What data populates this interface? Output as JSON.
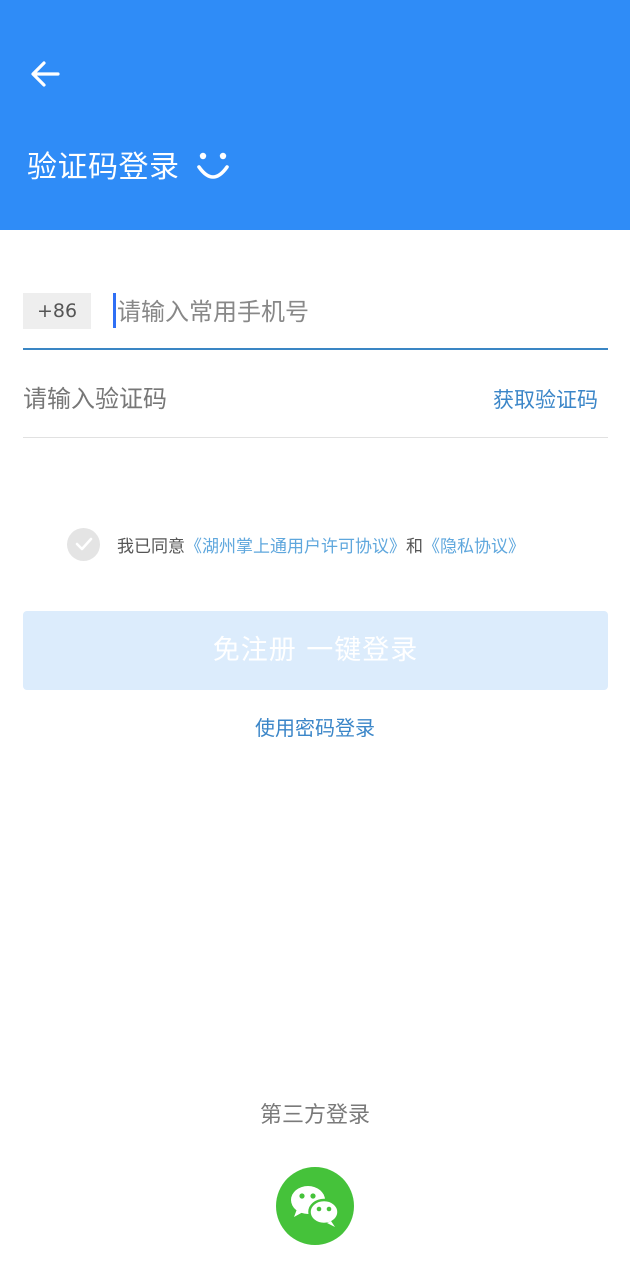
{
  "header": {
    "title": "验证码登录",
    "background_color": "#2f8cf7",
    "back_icon": "back-arrow-icon",
    "title_icon": "smile-icon"
  },
  "phone": {
    "country_code": "+86",
    "placeholder": "请输入常用手机号",
    "value": ""
  },
  "verify": {
    "placeholder": "请输入验证码",
    "value": "",
    "get_code_label": "获取验证码"
  },
  "agreement": {
    "checked": false,
    "prefix": "我已同意",
    "user_agreement": "《湖州掌上通用户许可协议》",
    "conjunction": "和",
    "privacy_policy": "《隐私协议》",
    "link_color": "#5fa7dd"
  },
  "login_button": {
    "label": "免注册 一键登录",
    "background_color": "#dcecfc"
  },
  "password_login": {
    "label": "使用密码登录"
  },
  "third_party": {
    "label": "第三方登录",
    "wechat_icon": "wechat-icon",
    "wechat_color": "#45c23a"
  }
}
